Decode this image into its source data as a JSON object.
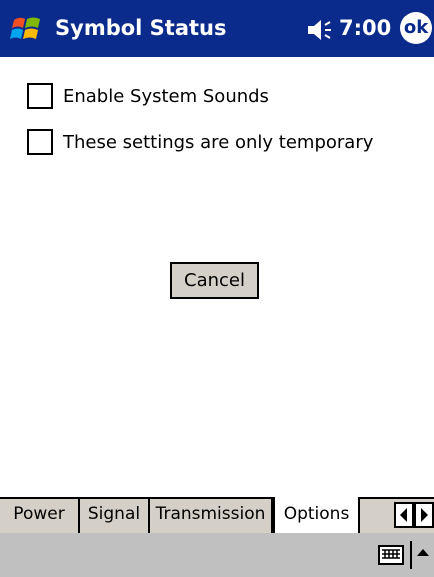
{
  "titlebar": {
    "title": "Symbol Status",
    "clock": "7:00",
    "ok_label": "ok"
  },
  "options": {
    "enable_sounds_label": "Enable System Sounds",
    "temporary_label": "These settings are only temporary",
    "cancel_label": "Cancel"
  },
  "tabs": [
    {
      "label": "Power"
    },
    {
      "label": "Signal"
    },
    {
      "label": "Transmission"
    },
    {
      "label": "Options"
    }
  ],
  "colors": {
    "titlebar": "#0a2a8c",
    "bar": "#c0c0c0"
  },
  "icons": [
    "windows-start-icon",
    "volume-icon",
    "keyboard-icon",
    "chevron-up-icon",
    "chevron-left-icon",
    "chevron-right-icon"
  ]
}
